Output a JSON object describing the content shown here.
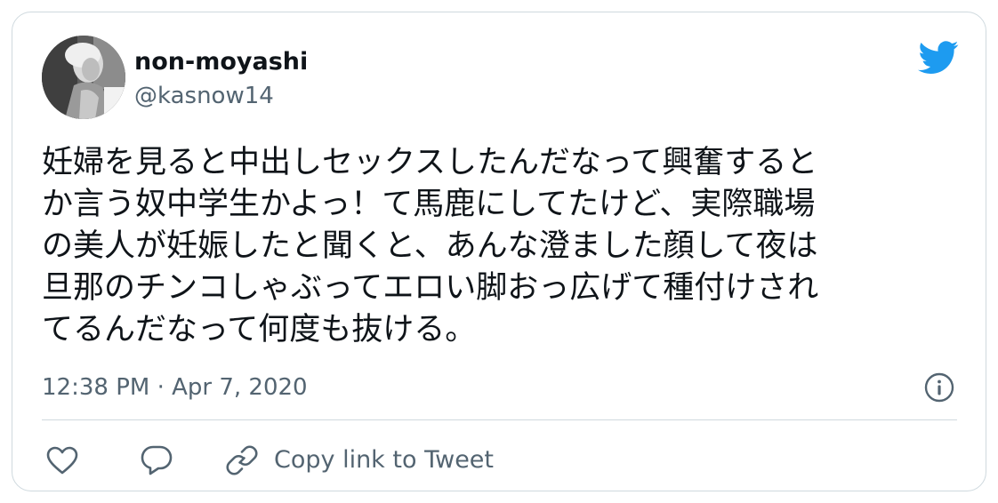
{
  "author": {
    "display_name": "non-moyashi",
    "handle": "@kasnow14"
  },
  "tweet": {
    "text": "妊婦を見ると中出しセックスしたんだなって興奮すると\nか言う奴中学生かよっ！て馬鹿にしてたけど、実際職場\nの美人が妊娠したと聞くと、あんな澄ました顔して夜は\n旦那のチンコしゃぶってエロい脚おっ広げて種付けされ\nてるんだなって何度も抜ける。",
    "timestamp": "12:38 PM · Apr 7, 2020"
  },
  "actions": {
    "copy_link_label": "Copy link to Tweet"
  },
  "icons": {
    "brand": "twitter-bird-icon",
    "info": "info-icon",
    "like": "heart-icon",
    "reply": "comment-icon",
    "copy": "link-icon"
  },
  "colors": {
    "twitter_blue": "#1d9bf0",
    "text_primary": "#0f1419",
    "text_secondary": "#536471",
    "border": "#cfd9de"
  }
}
